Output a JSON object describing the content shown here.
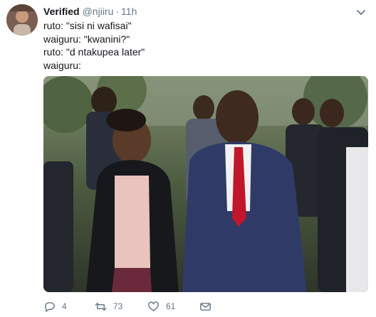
{
  "tweet": {
    "author_name": "Verified",
    "handle": "@njiiru",
    "separator": "·",
    "time": "11h",
    "lines": [
      "ruto: \"sisi ni wafisai\"",
      "waiguru: \"kwanini?\"",
      "ruto: \"d ntakupea later\"",
      "waiguru:"
    ],
    "actions": {
      "reply_count": "4",
      "retweet_count": "73",
      "like_count": "61"
    }
  },
  "icons": {
    "reply": "reply-icon",
    "retweet": "retweet-icon",
    "like": "heart-icon",
    "dm": "envelope-icon",
    "menu": "chevron-down-icon"
  },
  "colors": {
    "text": "#14171a",
    "secondary": "#657786",
    "tie": "#c0172c"
  }
}
